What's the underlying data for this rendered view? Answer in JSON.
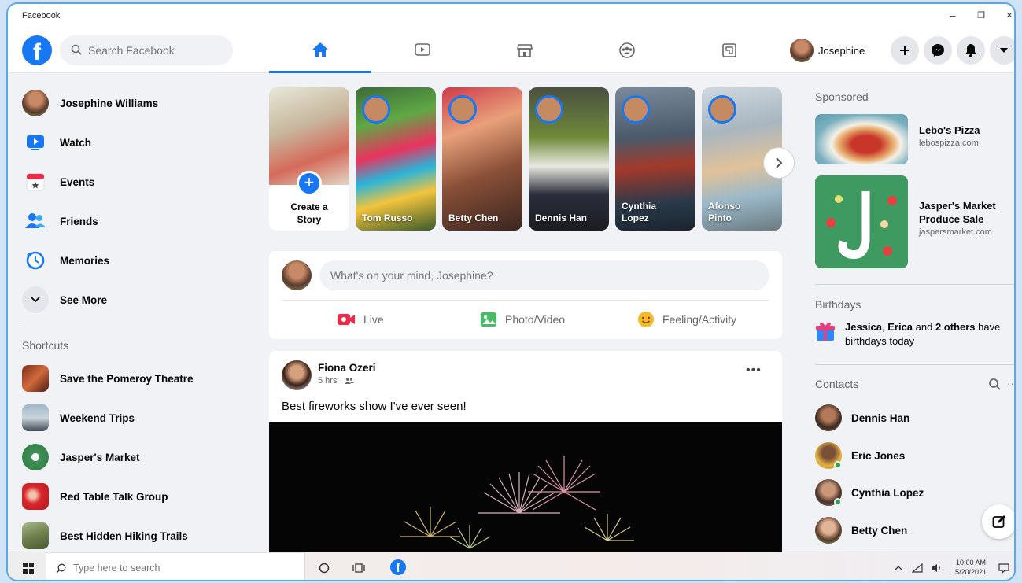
{
  "window": {
    "title": "Facebook",
    "minimize": "–",
    "restore": "❐",
    "close": "✕"
  },
  "topnav": {
    "search_placeholder": "Search Facebook",
    "profile_name": "Josephine"
  },
  "sidebar": {
    "items": [
      {
        "label": "Josephine Williams"
      },
      {
        "label": "Watch"
      },
      {
        "label": "Events"
      },
      {
        "label": "Friends"
      },
      {
        "label": "Memories"
      },
      {
        "label": "See More"
      }
    ],
    "shortcuts_title": "Shortcuts",
    "shortcuts": [
      {
        "label": "Save the Pomeroy Theatre"
      },
      {
        "label": "Weekend Trips"
      },
      {
        "label": "Jasper's Market"
      },
      {
        "label": "Red Table Talk Group"
      },
      {
        "label": "Best Hidden Hiking Trails"
      }
    ]
  },
  "stories": {
    "create_label_line1": "Create a",
    "create_label_line2": "Story",
    "items": [
      {
        "line1": "Tom Russo",
        "line2": ""
      },
      {
        "line1": "Betty Chen",
        "line2": ""
      },
      {
        "line1": "Dennis Han",
        "line2": ""
      },
      {
        "line1": "Cynthia",
        "line2": "Lopez"
      },
      {
        "line1": "Afonso",
        "line2": "Pinto"
      }
    ]
  },
  "composer": {
    "placeholder": "What's on your mind, Josephine?",
    "live_label": "Live",
    "photo_label": "Photo/Video",
    "feeling_label": "Feeling/Activity"
  },
  "post": {
    "author": "Fiona Ozeri",
    "time": "5 hrs ·",
    "more": "•••",
    "caption": "Best fireworks show I've ever seen!"
  },
  "right": {
    "sponsored_title": "Sponsored",
    "ads": [
      {
        "title": "Lebo's Pizza",
        "url": "lebospizza.com"
      },
      {
        "title_line1": "Jasper's Market",
        "title_line2": "Produce Sale",
        "url": "jaspersmarket.com"
      }
    ],
    "birthdays_title": "Birthdays",
    "birthday_names": "Jessica",
    "birthday_sep": ", ",
    "birthday_name2": "Erica",
    "birthday_and": " and ",
    "birthday_others": "2 others",
    "birthday_tail": " have",
    "birthday_line2": "birthdays today",
    "contacts_title": "Contacts",
    "contacts_more": "···",
    "contacts": [
      {
        "name": "Dennis Han"
      },
      {
        "name": "Eric Jones"
      },
      {
        "name": "Cynthia Lopez"
      },
      {
        "name": "Betty Chen"
      }
    ]
  },
  "taskbar": {
    "search_placeholder": "Type here to search",
    "time": "10:00 AM",
    "date": "5/20/2021"
  },
  "colors": {
    "brand": "#1877f2",
    "online": "#31a24c",
    "live": "#f02849",
    "photo": "#45bd62",
    "feeling": "#f7b928"
  }
}
